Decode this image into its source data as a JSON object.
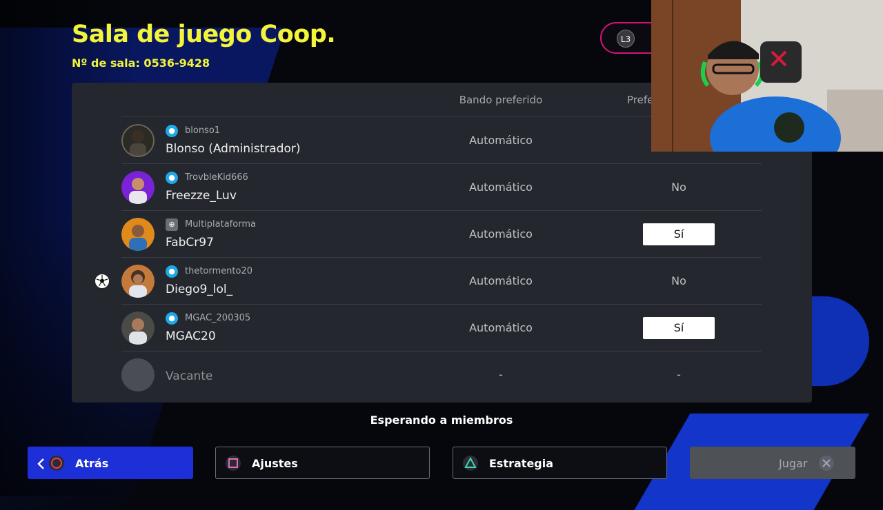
{
  "header": {
    "title": "Sala de juego Coop.",
    "room_number": "Nº de sala: 0536-9428"
  },
  "l3_button": {
    "label": "L3"
  },
  "table": {
    "columns": {
      "bando": "Bando preferido",
      "pref": "Prefe"
    },
    "rows": [
      {
        "user_id": "blonso1",
        "name": "Blonso (Administrador)",
        "platform": "playstation-icon",
        "bando": "Automático",
        "pref": "",
        "pref_highlighted": false
      },
      {
        "user_id": "TrovbleKid666",
        "name": "Freezze_Luv",
        "platform": "playstation-icon",
        "bando": "Automático",
        "pref": "No",
        "pref_highlighted": false
      },
      {
        "user_id": "Multiplataforma",
        "name": "FabCr97",
        "platform": "gamepad-icon",
        "bando": "Automático",
        "pref": "Sí",
        "pref_highlighted": true
      },
      {
        "user_id": "thetormento20",
        "name": "Diego9_lol_",
        "platform": "playstation-icon",
        "bando": "Automático",
        "pref": "No",
        "pref_highlighted": false
      },
      {
        "user_id": "MGAC_200305",
        "name": "MGAC20",
        "platform": "playstation-icon",
        "bando": "Automático",
        "pref": "Sí",
        "pref_highlighted": true
      }
    ],
    "vacant": {
      "name": "Vacante",
      "bando": "-",
      "pref": "-"
    }
  },
  "status": {
    "waiting": "Esperando a miembros"
  },
  "footer": {
    "back_label": "Atrás",
    "ajustes_label": "Ajustes",
    "estrategia_label": "Estrategia",
    "jugar_label": "Jugar"
  },
  "colors": {
    "title_yellow": "#f4f53a",
    "accent_blue": "#1d2fd6",
    "pill_magenta": "#d6127a"
  }
}
